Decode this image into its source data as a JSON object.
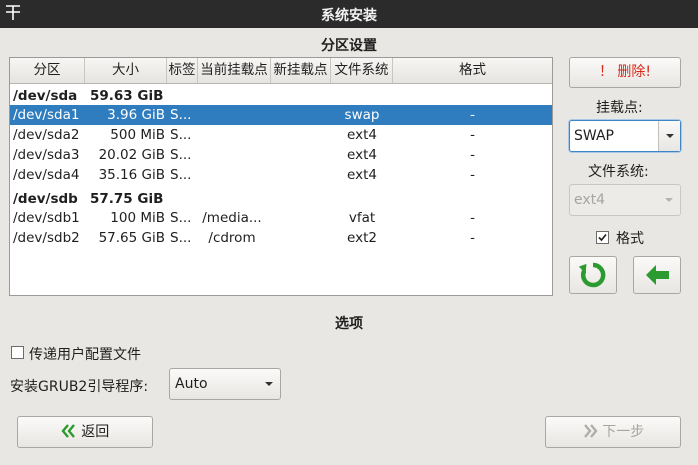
{
  "window": {
    "title": "系统安装",
    "menu_icon": "pin-icon"
  },
  "partition_section": {
    "title": "分区设置"
  },
  "table": {
    "columns": [
      "分区",
      "大小",
      "标签",
      "当前挂载点",
      "新挂载点",
      "文件系统",
      "格式"
    ],
    "groups": [
      {
        "device": "/dev/sda",
        "size": "59.63 GiB",
        "rows": [
          {
            "partition": "/dev/sda1",
            "size": "3.96 GiB",
            "label": "S...",
            "current_mount": "",
            "new_mount": "",
            "filesystem": "swap",
            "format": "-"
          },
          {
            "partition": "/dev/sda2",
            "size": "500 MiB",
            "label": "S...",
            "current_mount": "",
            "new_mount": "",
            "filesystem": "ext4",
            "format": "-"
          },
          {
            "partition": "/dev/sda3",
            "size": "20.02 GiB",
            "label": "S...",
            "current_mount": "",
            "new_mount": "",
            "filesystem": "ext4",
            "format": "-"
          },
          {
            "partition": "/dev/sda4",
            "size": "35.16 GiB",
            "label": "S...",
            "current_mount": "",
            "new_mount": "",
            "filesystem": "ext4",
            "format": "-"
          }
        ]
      },
      {
        "device": "/dev/sdb",
        "size": "57.75 GiB",
        "rows": [
          {
            "partition": "/dev/sdb1",
            "size": "100 MiB",
            "label": "S...",
            "current_mount": "/media...",
            "new_mount": "",
            "filesystem": "vfat",
            "format": "-"
          },
          {
            "partition": "/dev/sdb2",
            "size": "57.65 GiB",
            "label": "S...",
            "current_mount": "/cdrom",
            "new_mount": "",
            "filesystem": "ext2",
            "format": "-"
          }
        ]
      }
    ]
  },
  "side_panel": {
    "delete_label": "！ 删除!",
    "mount_point_label": "挂载点:",
    "mount_point_value": "SWAP",
    "filesystem_label": "文件系统:",
    "filesystem_value": "ext4",
    "format_label": "格式",
    "format_checked": true,
    "reset_icon": "refresh-icon",
    "apply_icon": "arrow-left-icon"
  },
  "options_section": {
    "title": "选项",
    "pass_user_config_label": "传递用户配置文件",
    "grub_label": "安装GRUB2引导程序:",
    "grub_value": "Auto"
  },
  "footer": {
    "back_label": "返回",
    "next_label": "下一步"
  },
  "colors": {
    "selection": "#2f7dbe",
    "delete_text": "#d9271a",
    "green_icon": "#2c9b2f"
  }
}
